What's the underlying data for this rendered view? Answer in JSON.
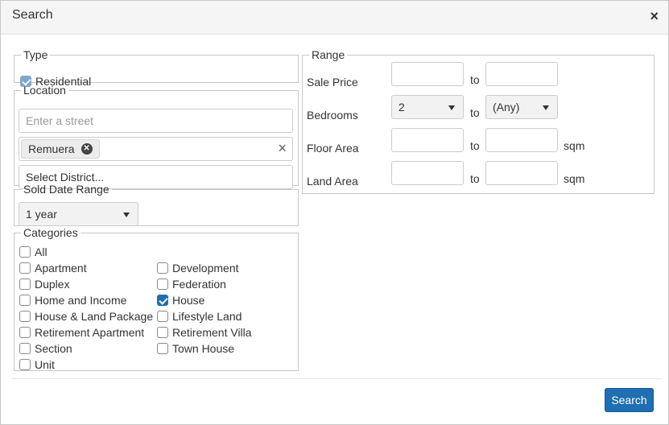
{
  "dialog": {
    "title": "Search",
    "close_symbol": "×"
  },
  "type_section": {
    "legend": "Type",
    "option": {
      "label": "Residential",
      "checked": true
    }
  },
  "location": {
    "legend": "Location",
    "street_placeholder": "Enter a street",
    "suburb_tag": "Remuera",
    "clear_symbol": "×",
    "district_placeholder": "Select District..."
  },
  "sold_date": {
    "legend": "Sold Date Range",
    "value": "1 year"
  },
  "categories": {
    "legend": "Categories",
    "all_label": "All",
    "left": [
      {
        "label": "Apartment",
        "checked": false
      },
      {
        "label": "Duplex",
        "checked": false
      },
      {
        "label": "Home and Income",
        "checked": false
      },
      {
        "label": "House & Land Package",
        "checked": false
      },
      {
        "label": "Retirement Apartment",
        "checked": false
      },
      {
        "label": "Section",
        "checked": false
      },
      {
        "label": "Unit",
        "checked": false
      }
    ],
    "right": [
      {
        "label": "Development",
        "checked": false
      },
      {
        "label": "Federation",
        "checked": false
      },
      {
        "label": "House",
        "checked": true
      },
      {
        "label": "Lifestyle Land",
        "checked": false
      },
      {
        "label": "Retirement Villa",
        "checked": false
      },
      {
        "label": "Town House",
        "checked": false
      }
    ]
  },
  "range": {
    "legend": "Range",
    "to_label": "to",
    "unit": "sqm",
    "sale_price": {
      "label": "Sale Price",
      "min": "",
      "max": ""
    },
    "bedrooms": {
      "label": "Bedrooms",
      "min": "2",
      "max": "(Any)"
    },
    "floor_area": {
      "label": "Floor Area",
      "min": "",
      "max": ""
    },
    "land_area": {
      "label": "Land Area",
      "min": "",
      "max": ""
    }
  },
  "footer": {
    "search_label": "Search"
  },
  "colors": {
    "primary": "#1f6fb2"
  }
}
